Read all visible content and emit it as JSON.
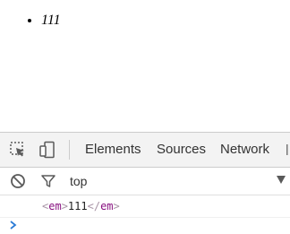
{
  "page": {
    "list_item_text": "111"
  },
  "devtools": {
    "tabs": [
      {
        "label": "Elements"
      },
      {
        "label": "Sources"
      },
      {
        "label": "Network"
      }
    ],
    "context_selector": "top",
    "console_message": {
      "open_tag": "<",
      "tag_name": "em",
      "close_bracket": ">",
      "text": "111",
      "close_open": "</",
      "close_tag_name": "em",
      "close_end": ">"
    },
    "icons": {
      "inspect": "inspect-element-icon",
      "device": "device-toolbar-icon",
      "clear": "clear-console-icon",
      "filter": "filter-icon",
      "dropdown": "chevron-down-icon",
      "prompt": "console-prompt-icon"
    },
    "colors": {
      "toolbar_bg": "#f3f3f3",
      "tag_punctuation": "#a894a6",
      "tag_name": "#881280",
      "prompt": "#2b7bd6"
    }
  }
}
